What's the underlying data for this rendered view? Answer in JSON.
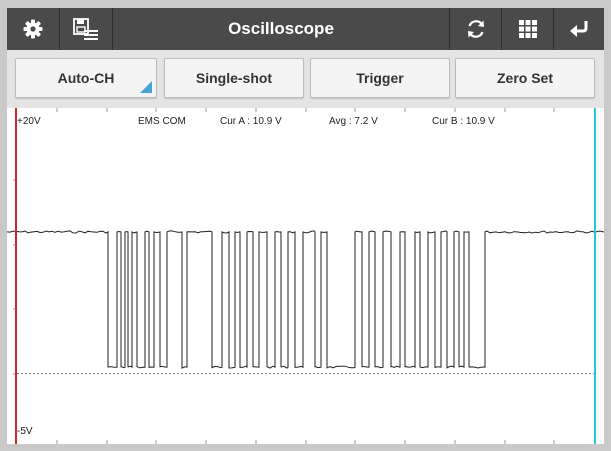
{
  "window": {
    "title": "Oscilloscope"
  },
  "titlebar": {
    "icons": [
      "gear-icon",
      "save-list-icon",
      "refresh-icon",
      "grid-icon",
      "return-icon"
    ]
  },
  "toolbar": {
    "buttons": [
      {
        "label": "Auto-CH"
      },
      {
        "label": "Single-shot"
      },
      {
        "label": "Trigger"
      },
      {
        "label": "Zero Set"
      }
    ]
  },
  "scope": {
    "y_top_label": "+20V",
    "y_bottom_label": "-5V",
    "channel_label": "EMS COM",
    "cursor_a": "Cur A : 10.9 V",
    "avg": "Avg : 7.2 V",
    "cursor_b": "Cur B : 10.9 V",
    "y_range": [
      -5,
      20
    ],
    "baseline_level": 11.0,
    "low_level": 0.5,
    "zero_level": 0,
    "cursor_a_color": "#e02020",
    "cursor_b_color": "#22c8e0",
    "signal_color": "#202020"
  },
  "colors": {
    "titlebar_bg": "#4a4a4a",
    "toolbar_bg": "#e4e4e4",
    "accent": "#4aa3d6"
  }
}
